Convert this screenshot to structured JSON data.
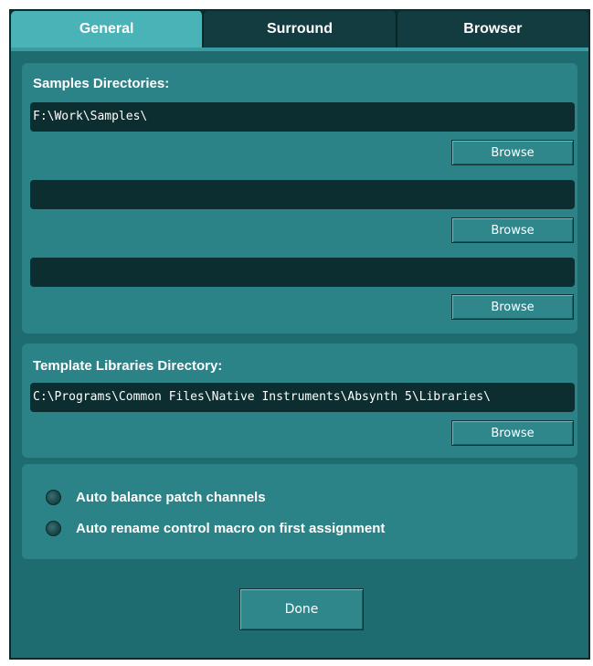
{
  "tabs": [
    {
      "label": "General",
      "active": true
    },
    {
      "label": "Surround",
      "active": false
    },
    {
      "label": "Browser",
      "active": false
    }
  ],
  "samples": {
    "label": "Samples Directories:",
    "fields": [
      {
        "value": "F:\\Work\\Samples\\"
      },
      {
        "value": ""
      },
      {
        "value": ""
      }
    ],
    "browse_label": "Browse"
  },
  "templates": {
    "label": "Template Libraries Directory:",
    "value": "C:\\Programs\\Common Files\\Native Instruments\\Absynth 5\\Libraries\\",
    "browse_label": "Browse"
  },
  "options": [
    {
      "label": "Auto balance patch channels",
      "checked": false
    },
    {
      "label": "Auto rename control macro on first assignment",
      "checked": false
    }
  ],
  "done_label": "Done",
  "colors": {
    "window_bg": "#1e6b70",
    "panel_bg": "#2b8287",
    "active_tab": "#4ab3b8",
    "inactive_tab": "#123c3f",
    "field_bg": "#0d2e30"
  }
}
